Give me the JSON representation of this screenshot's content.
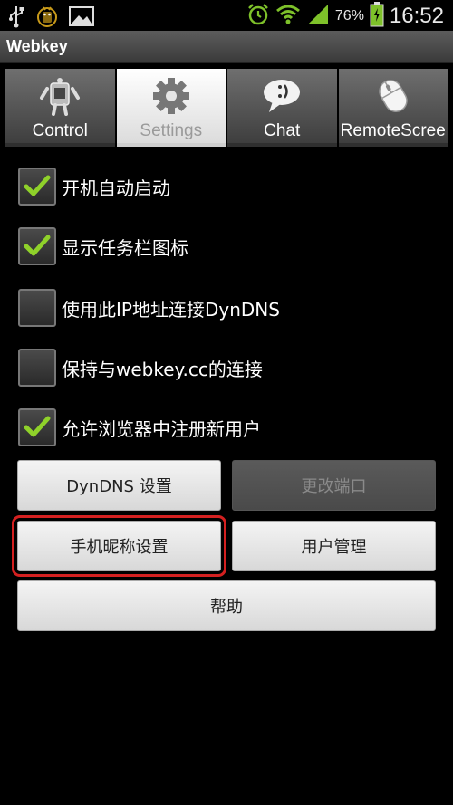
{
  "status_bar": {
    "icons_left": [
      "usb-icon",
      "android-debug-icon",
      "image-icon"
    ],
    "icons_right": [
      "alarm-icon",
      "wifi-icon",
      "signal-icon",
      "battery-icon"
    ],
    "battery": "76%",
    "time": "16:52",
    "colors": {
      "green": "#7ec12a"
    }
  },
  "app": {
    "title": "Webkey"
  },
  "tabs": [
    {
      "label": "Control",
      "icon": "robot-icon",
      "active": false
    },
    {
      "label": "Settings",
      "icon": "gear-icon",
      "active": true
    },
    {
      "label": "Chat",
      "icon": "chat-bubble-icon",
      "active": false
    },
    {
      "label": "RemoteScree",
      "icon": "mouse-icon",
      "active": false
    }
  ],
  "options": [
    {
      "label": "开机自动启动",
      "checked": true
    },
    {
      "label": "显示任务栏图标",
      "checked": true
    },
    {
      "label": "使用此IP地址连接DynDNS",
      "checked": false
    },
    {
      "label": "保持与webkey.cc的连接",
      "checked": false
    },
    {
      "label": "允许浏览器中注册新用户",
      "checked": true
    }
  ],
  "buttons": {
    "dyndns": "DynDNS 设置",
    "change_port": "更改端口",
    "nickname": "手机昵称设置",
    "user_mgmt": "用户管理",
    "help": "帮助"
  },
  "colors": {
    "check": "#8fd12a",
    "highlight_border": "#d42020"
  }
}
